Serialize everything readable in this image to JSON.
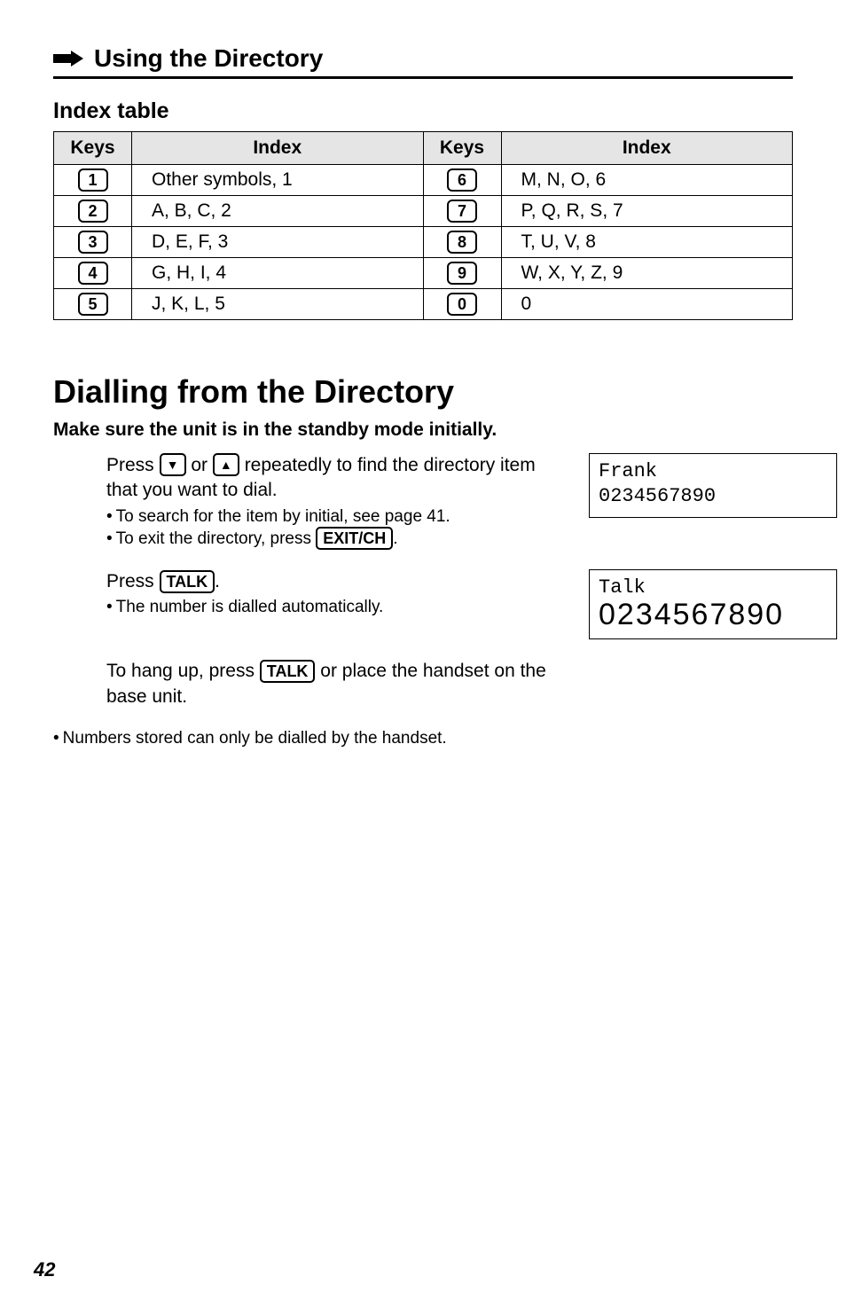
{
  "chapter": {
    "title": "Using the Directory"
  },
  "index_section": {
    "title": "Index table",
    "headers": {
      "keys": "Keys",
      "index": "Index"
    },
    "rows_left": [
      {
        "key": "1",
        "label": "Other symbols, 1"
      },
      {
        "key": "2",
        "label": "A, B, C, 2"
      },
      {
        "key": "3",
        "label": "D, E, F, 3"
      },
      {
        "key": "4",
        "label": "G, H, I, 4"
      },
      {
        "key": "5",
        "label": "J, K, L, 5"
      }
    ],
    "rows_right": [
      {
        "key": "6",
        "label": "M, N, O, 6"
      },
      {
        "key": "7",
        "label": "P, Q, R, S, 7"
      },
      {
        "key": "8",
        "label": "T, U, V, 8"
      },
      {
        "key": "9",
        "label": "W, X, Y, Z, 9"
      },
      {
        "key": "0",
        "label": "0"
      }
    ]
  },
  "dialling": {
    "title": "Dialling from the Directory",
    "lead": "Make sure the unit is in the standby mode initially.",
    "step1": {
      "pre": "Press ",
      "mid": " or ",
      "post": " repeatedly to find the directory item that you want to dial.",
      "bullets": [
        "To search for the item by initial, see page 41.",
        "To exit the directory, press "
      ],
      "exit_key": "EXIT/CH",
      "display_line1": "Frank",
      "display_line2": "0234567890"
    },
    "step2": {
      "pre": "Press ",
      "talk_key": "TALK",
      "post": ".",
      "bullet": "The number is dialled automatically.",
      "display_line1": "Talk",
      "display_line2": "0234567890"
    },
    "step3": {
      "pre": "To hang up, press ",
      "talk_key": "TALK",
      "post": " or place the handset on the base unit."
    },
    "footnote": "Numbers stored can only be dialled by the handset."
  },
  "page_number": "42"
}
